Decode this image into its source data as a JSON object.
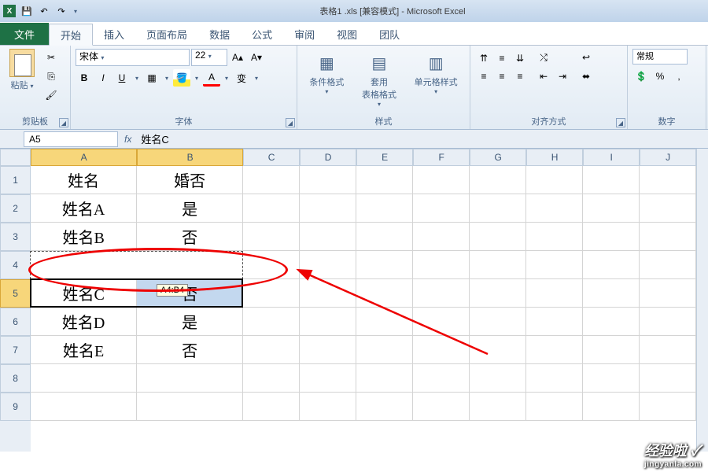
{
  "title": "表格1 .xls  [兼容模式] - Microsoft Excel",
  "tabs": {
    "file": "文件",
    "home": "开始",
    "insert": "插入",
    "layout": "页面布局",
    "data": "数据",
    "formula": "公式",
    "review": "审阅",
    "view": "视图",
    "team": "团队"
  },
  "groups": {
    "clipboard": "剪贴板",
    "font": "字体",
    "styles": "样式",
    "align": "对齐方式",
    "number": "数字"
  },
  "ribbon": {
    "paste": "粘贴",
    "font_name": "宋体",
    "font_size": "22",
    "cond_fmt": "条件格式",
    "table_fmt": "套用\n表格格式",
    "cell_fmt": "单元格样式",
    "number_fmt": "常规",
    "bold": "B",
    "italic": "I",
    "underline": "U"
  },
  "namebox": "A5",
  "formula": "姓名C",
  "cols": [
    "A",
    "B",
    "C",
    "D",
    "E",
    "F",
    "G",
    "H",
    "I",
    "J"
  ],
  "rows": [
    "1",
    "2",
    "3",
    "4",
    "5",
    "6",
    "7",
    "8",
    "9"
  ],
  "cells": {
    "r1": {
      "a": "姓名",
      "b": "婚否"
    },
    "r2": {
      "a": "姓名A",
      "b": "是"
    },
    "r3": {
      "a": "姓名B",
      "b": "否"
    },
    "r5": {
      "a": "姓名C",
      "b": "否"
    },
    "r6": {
      "a": "姓名D",
      "b": "是"
    },
    "r7": {
      "a": "姓名E",
      "b": "否"
    }
  },
  "tooltip": "A4:B4",
  "watermark": {
    "big": "经验啦 ✓",
    "small": "jingyanla.com"
  }
}
